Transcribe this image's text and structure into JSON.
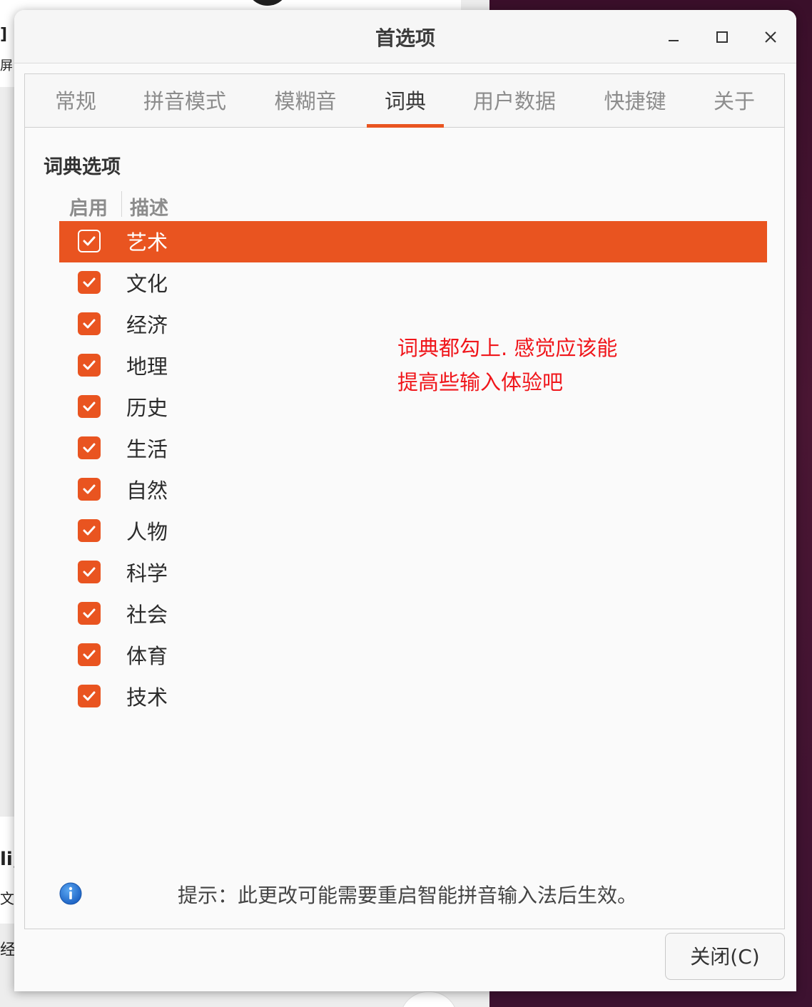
{
  "background": {
    "left_fragments": [
      "]",
      "屏",
      "li,",
      "文 ",
      "经:"
    ]
  },
  "window": {
    "title": "首选项",
    "controls": {
      "minimize": "minimize-icon",
      "maximize": "maximize-icon",
      "close": "close-icon"
    }
  },
  "tabs": [
    {
      "label": "常规",
      "active": false
    },
    {
      "label": "拼音模式",
      "active": false
    },
    {
      "label": "模糊音",
      "active": false
    },
    {
      "label": "词典",
      "active": true
    },
    {
      "label": "用户数据",
      "active": false
    },
    {
      "label": "快捷键",
      "active": false
    },
    {
      "label": "关于",
      "active": false
    }
  ],
  "dictionary": {
    "section_title": "词典选项",
    "columns": {
      "enable": "启用",
      "description": "描述"
    },
    "items": [
      {
        "label": "艺术",
        "checked": true,
        "selected": true
      },
      {
        "label": "文化",
        "checked": true,
        "selected": false
      },
      {
        "label": "经济",
        "checked": true,
        "selected": false
      },
      {
        "label": "地理",
        "checked": true,
        "selected": false
      },
      {
        "label": "历史",
        "checked": true,
        "selected": false
      },
      {
        "label": "生活",
        "checked": true,
        "selected": false
      },
      {
        "label": "自然",
        "checked": true,
        "selected": false
      },
      {
        "label": "人物",
        "checked": true,
        "selected": false
      },
      {
        "label": "科学",
        "checked": true,
        "selected": false
      },
      {
        "label": "社会",
        "checked": true,
        "selected": false
      },
      {
        "label": "体育",
        "checked": true,
        "selected": false
      },
      {
        "label": "技术",
        "checked": true,
        "selected": false
      }
    ]
  },
  "annotation": {
    "line1": "词典都勾上. 感觉应该能",
    "line2": "提高些输入体验吧"
  },
  "hint": {
    "icon": "info-icon",
    "text": "提示：此更改可能需要重启智能拼音输入法后生效。"
  },
  "buttons": {
    "close_label": "关闭(C)"
  },
  "colors": {
    "accent": "#e95420",
    "annotation": "#f0161b",
    "info_icon": "#2a7de1"
  }
}
